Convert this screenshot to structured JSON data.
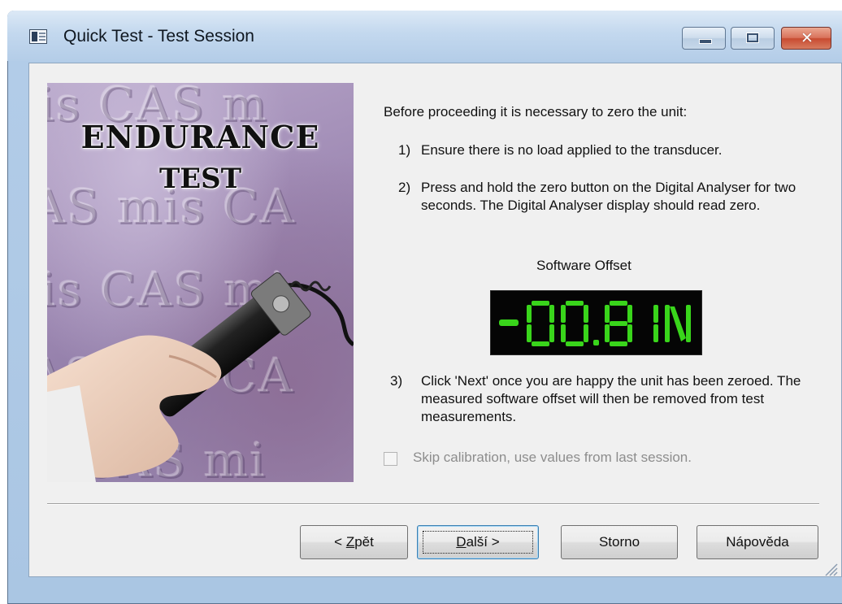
{
  "window": {
    "title": "Quick Test - Test Session",
    "controls": [
      "minimize",
      "maximize",
      "close"
    ]
  },
  "hero": {
    "title_line1": "ENDURANCE",
    "title_line2": "TEST"
  },
  "instructions": {
    "intro": "Before proceeding it is necessary to zero the unit:",
    "step1_num": "1)",
    "step1": "Ensure there is no load applied to the transducer.",
    "step2_num": "2)",
    "step2": "Press and hold the zero button on the Digital Analyser for two seconds. The Digital Analyser display should read zero.",
    "offset_label": "Software Offset",
    "offset_value": "-00.8",
    "offset_unit": "IN",
    "step3_num": "3)",
    "step3": "Click 'Next' once you are happy the unit has been zeroed. The measured software offset will then be removed from test measurements."
  },
  "skip_calibration": {
    "label": "Skip calibration, use values from last session.",
    "checked": false,
    "enabled": false
  },
  "buttons": {
    "back_prefix": "< ",
    "back_key": "Z",
    "back_rest": "pět",
    "next_key": "D",
    "next_rest": "alší >",
    "cancel": "Storno",
    "help": "Nápověda"
  },
  "colors": {
    "display_bg": "#050505",
    "display_fg": "#39d51b",
    "hero_bg": "#9f8ab4"
  }
}
